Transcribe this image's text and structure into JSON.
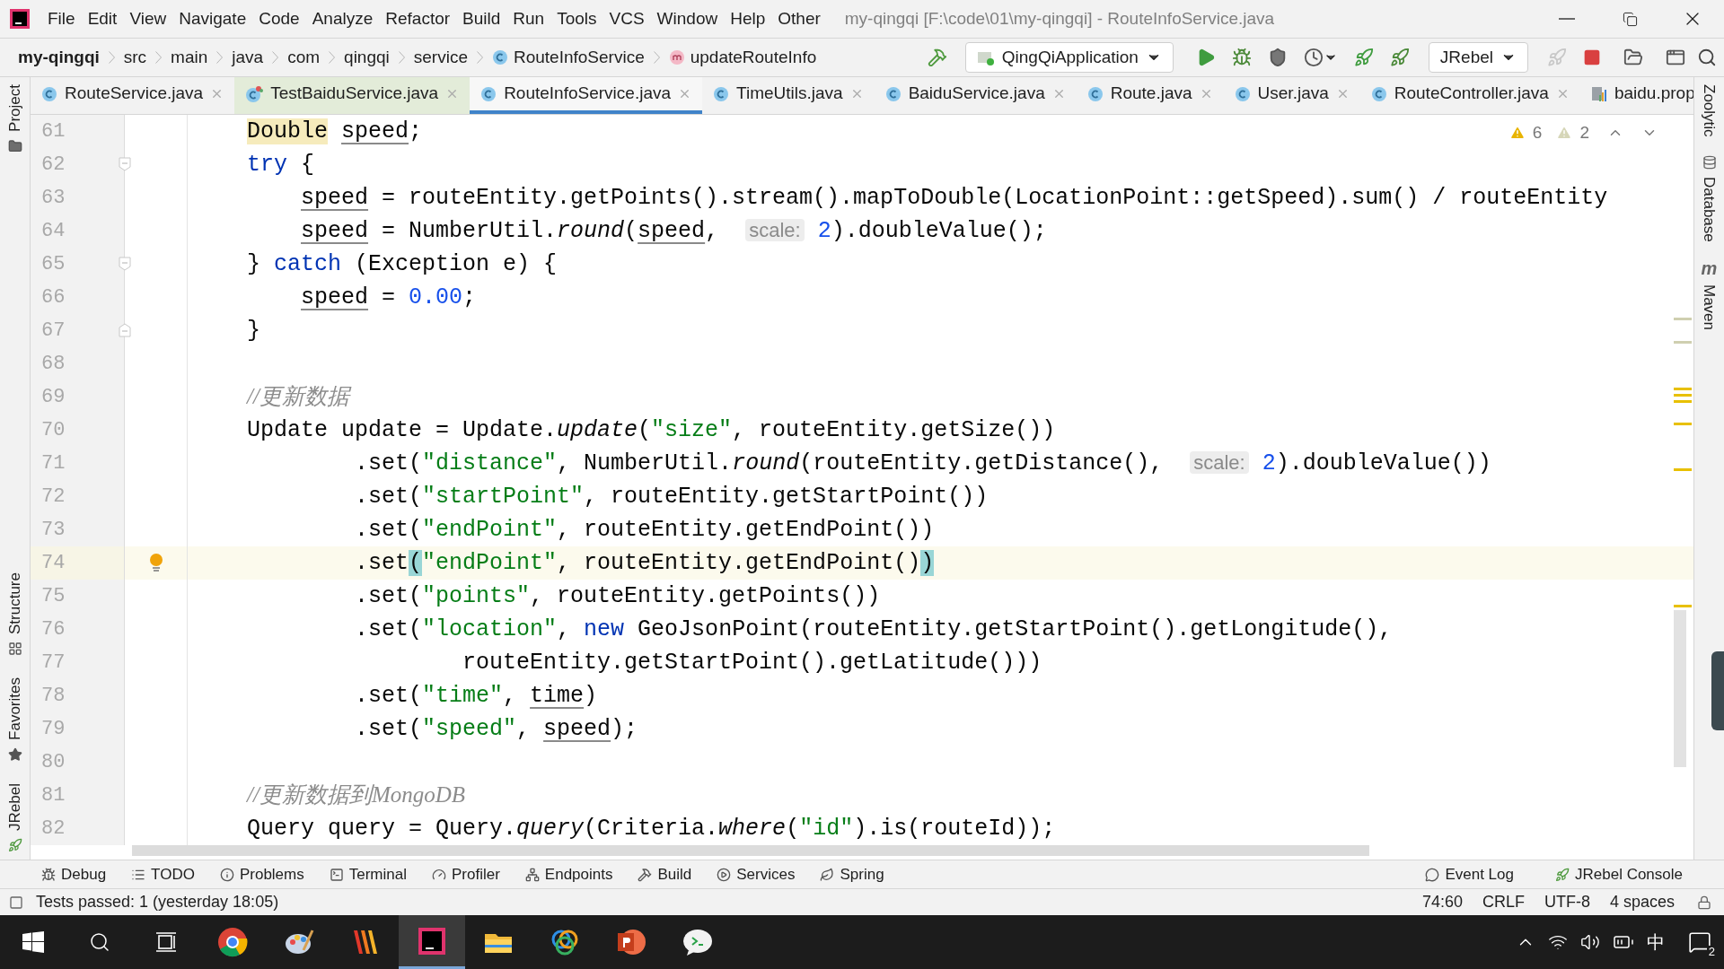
{
  "title_bar": {
    "menu": [
      "File",
      "Edit",
      "View",
      "Navigate",
      "Code",
      "Analyze",
      "Refactor",
      "Build",
      "Run",
      "Tools",
      "VCS",
      "Window",
      "Help",
      "Other"
    ],
    "title": "my-qingqi [F:\\code\\01\\my-qingqi] - RouteInfoService.java"
  },
  "nav_bar": {
    "breadcrumbs": [
      {
        "label": "my-qingqi",
        "bold": true
      },
      {
        "label": "src",
        "bold": false
      },
      {
        "label": "main",
        "bold": false
      },
      {
        "label": "java",
        "bold": false
      },
      {
        "label": "com",
        "bold": false
      },
      {
        "label": "qingqi",
        "bold": false
      },
      {
        "label": "service",
        "bold": false
      },
      {
        "label": "RouteInfoService",
        "bold": false,
        "kind": "class"
      },
      {
        "label": "updateRouteInfo",
        "bold": false,
        "kind": "method"
      }
    ],
    "run_config": "QingQiApplication",
    "jrebel_config": "JRebel"
  },
  "tabs": [
    {
      "label": "RouteService.java",
      "kind": "class",
      "selected": false
    },
    {
      "label": "TestBaiduService.java",
      "kind": "test",
      "selected": false
    },
    {
      "label": "RouteInfoService.java",
      "kind": "class",
      "selected": true
    },
    {
      "label": "TimeUtils.java",
      "kind": "class",
      "selected": false
    },
    {
      "label": "BaiduService.java",
      "kind": "class",
      "selected": false
    },
    {
      "label": "Route.java",
      "kind": "class",
      "selected": false
    },
    {
      "label": "User.java",
      "kind": "class",
      "selected": false
    },
    {
      "label": "RouteController.java",
      "kind": "class",
      "selected": false
    },
    {
      "label": "baidu.prop",
      "kind": "properties",
      "selected": false
    }
  ],
  "left_tool_strip": {
    "top": [
      {
        "label": "Project",
        "kind": "folder"
      }
    ],
    "bottom": [
      {
        "label": "Structure",
        "kind": "structure"
      },
      {
        "label": "Favorites",
        "kind": "star"
      },
      {
        "label": "JRebel",
        "kind": "rocket"
      }
    ]
  },
  "right_tool_strip": [
    {
      "label": "Zoolytic",
      "kind": "plain"
    },
    {
      "label": "Database",
      "kind": "database"
    },
    {
      "label": "Maven",
      "kind": "glyph",
      "glyph": "m"
    }
  ],
  "editor": {
    "warnings": "6",
    "weak_warnings": "2",
    "lines": [
      {
        "number": "61",
        "current": false,
        "tokens": [
          {
            "kind": "highlight",
            "text": "Double"
          },
          {
            "kind": "field",
            "text": " speed"
          },
          {
            "text": ";"
          }
        ]
      },
      {
        "number": "62",
        "current": false,
        "kind": "fold_start",
        "tokens": [
          {
            "kind": "keyword",
            "text": "try"
          },
          {
            "text": " {"
          }
        ]
      },
      {
        "number": "63",
        "current": false,
        "tokens": [
          {
            "kind": "field",
            "text": "    speed"
          },
          {
            "text": " = routeEntity.getPoints().stream().mapToDouble(LocationPoint::getSpeed).sum() / routeEntity"
          }
        ]
      },
      {
        "number": "64",
        "current": false,
        "tokens": [
          {
            "kind": "field",
            "text": "    speed"
          },
          {
            "text": " = NumberUtil."
          },
          {
            "kind": "static",
            "text": "round"
          },
          {
            "text": "("
          },
          {
            "kind": "field",
            "text": "speed"
          },
          {
            "text": ",  "
          },
          {
            "kind": "hint",
            "text": "scale:"
          },
          {
            "kind": "number",
            "text": " 2"
          },
          {
            "text": ").doubleValue();"
          }
        ]
      },
      {
        "number": "65",
        "current": false,
        "kind": "fold_start",
        "tokens": [
          {
            "text": "} "
          },
          {
            "kind": "keyword",
            "text": "catch"
          },
          {
            "text": " (Exception e) {"
          }
        ]
      },
      {
        "number": "66",
        "current": false,
        "tokens": [
          {
            "kind": "field",
            "text": "    speed"
          },
          {
            "text": " = "
          },
          {
            "kind": "number",
            "text": "0.00"
          },
          {
            "text": ";"
          }
        ]
      },
      {
        "number": "67",
        "current": false,
        "kind": "fold_end",
        "tokens": [
          {
            "text": "}"
          }
        ]
      },
      {
        "number": "68",
        "current": false
      },
      {
        "number": "69",
        "current": false,
        "tokens": [
          {
            "kind": "comment",
            "text": "//更新数据"
          }
        ]
      },
      {
        "number": "70",
        "current": false,
        "tokens": [
          {
            "text": "Update update = Update."
          },
          {
            "kind": "static",
            "text": "update"
          },
          {
            "text": "("
          },
          {
            "kind": "string",
            "text": "\"size\""
          },
          {
            "text": ", routeEntity.getSize())"
          }
        ]
      },
      {
        "number": "71",
        "current": false,
        "tokens": [
          {
            "text": "        .set("
          },
          {
            "kind": "string",
            "text": "\"distance\""
          },
          {
            "text": ", NumberUtil."
          },
          {
            "kind": "static",
            "text": "round"
          },
          {
            "text": "(routeEntity.getDistance(),  "
          },
          {
            "kind": "hint",
            "text": "scale:"
          },
          {
            "kind": "number",
            "text": " 2"
          },
          {
            "text": ").doubleValue())"
          }
        ]
      },
      {
        "number": "72",
        "current": false,
        "tokens": [
          {
            "text": "        .set("
          },
          {
            "kind": "string",
            "text": "\"startPoint\""
          },
          {
            "text": ", routeEntity.getStartPoint())"
          }
        ]
      },
      {
        "number": "73",
        "current": false,
        "tokens": [
          {
            "text": "        .set("
          },
          {
            "kind": "string",
            "text": "\"endPoint\""
          },
          {
            "text": ", routeEntity.getEndPoint())"
          }
        ]
      },
      {
        "number": "74",
        "current": true,
        "bulb": true,
        "tokens": [
          {
            "text": "        .set"
          },
          {
            "kind": "brace_match",
            "text": "("
          },
          {
            "kind": "string",
            "text": "\"endPoint\""
          },
          {
            "text": ", routeEntity.getEndPoint()"
          },
          {
            "kind": "brace_match",
            "text": ")"
          }
        ]
      },
      {
        "number": "75",
        "current": false,
        "tokens": [
          {
            "text": "        .set("
          },
          {
            "kind": "string",
            "text": "\"points\""
          },
          {
            "text": ", routeEntity.getPoints())"
          }
        ]
      },
      {
        "number": "76",
        "current": false,
        "tokens": [
          {
            "text": "        .set("
          },
          {
            "kind": "string",
            "text": "\"location\""
          },
          {
            "text": ", "
          },
          {
            "kind": "keyword",
            "text": "new"
          },
          {
            "text": " GeoJsonPoint(routeEntity.getStartPoint().getLongitude(),"
          }
        ]
      },
      {
        "number": "77",
        "current": false,
        "tokens": [
          {
            "text": "                routeEntity.getStartPoint().getLatitude()))"
          }
        ]
      },
      {
        "number": "78",
        "current": false,
        "tokens": [
          {
            "text": "        .set("
          },
          {
            "kind": "string",
            "text": "\"time\""
          },
          {
            "text": ", "
          },
          {
            "kind": "field",
            "text": "time"
          },
          {
            "text": ")"
          }
        ]
      },
      {
        "number": "79",
        "current": false,
        "tokens": [
          {
            "text": "        .set("
          },
          {
            "kind": "string",
            "text": "\"speed\""
          },
          {
            "text": ", "
          },
          {
            "kind": "field",
            "text": "speed"
          },
          {
            "text": ");"
          }
        ]
      },
      {
        "number": "80",
        "current": false
      },
      {
        "number": "81",
        "current": false,
        "tokens": [
          {
            "kind": "comment",
            "text": "//更新数据到MongoDB"
          }
        ]
      },
      {
        "number": "82",
        "current": false,
        "tokens": [
          {
            "text": "Query query = Query."
          },
          {
            "kind": "static",
            "text": "query"
          },
          {
            "text": "(Criteria."
          },
          {
            "kind": "static",
            "text": "where"
          },
          {
            "text": "("
          },
          {
            "kind": "string",
            "text": "\"id\""
          },
          {
            "text": ").is(routeId));"
          }
        ]
      }
    ]
  },
  "tool_windows": {
    "left": [
      {
        "label": "Debug",
        "kind": "bug"
      },
      {
        "label": "TODO",
        "kind": "list"
      },
      {
        "label": "Problems",
        "kind": "info"
      },
      {
        "label": "Terminal",
        "kind": "terminal"
      },
      {
        "label": "Profiler",
        "kind": "gauge"
      },
      {
        "label": "Endpoints",
        "kind": "network"
      },
      {
        "label": "Build",
        "kind": "hammer"
      },
      {
        "label": "Services",
        "kind": "play"
      },
      {
        "label": "Spring",
        "kind": "leaf"
      }
    ],
    "right": [
      {
        "label": "Event Log",
        "kind": "message"
      },
      {
        "label": "JRebel Console",
        "kind": "rocket"
      }
    ]
  },
  "status_bar": {
    "message": "Tests passed: 1 (yesterday 18:05)",
    "items": [
      "74:60",
      "CRLF",
      "UTF-8",
      "4 spaces"
    ]
  },
  "taskbar": {
    "apps": [
      {
        "kind": "browser",
        "selected": false
      },
      {
        "kind": "palette",
        "selected": false
      },
      {
        "kind": "stripes",
        "selected": false
      },
      {
        "kind": "ide",
        "selected": true
      },
      {
        "kind": "folder",
        "selected": false
      },
      {
        "kind": "rings",
        "selected": false
      },
      {
        "kind": "slides",
        "selected": false
      },
      {
        "kind": "chat",
        "selected": false
      }
    ],
    "ime": "中",
    "notifications": "2"
  }
}
